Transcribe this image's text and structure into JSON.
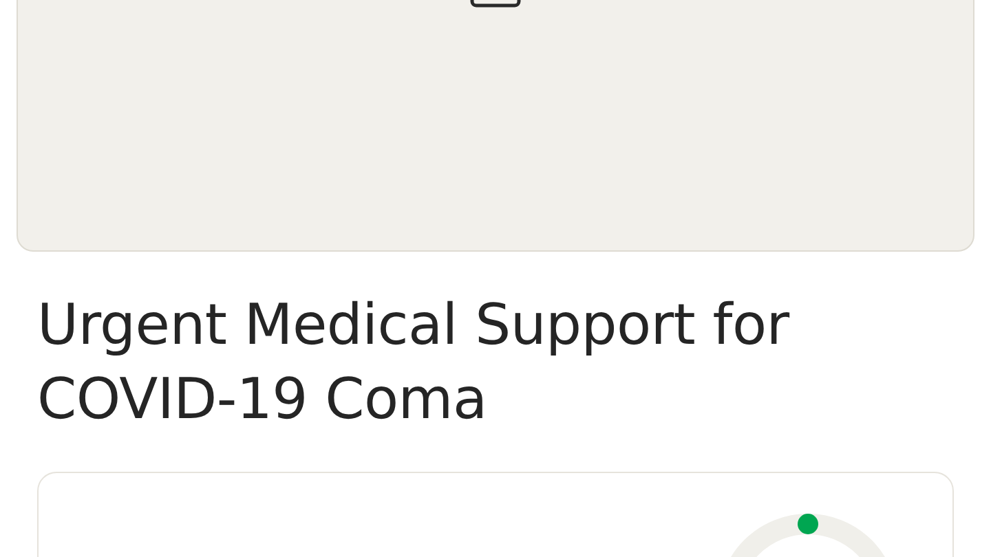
{
  "title": "Urgent Medical Support for COVID-19 Coma",
  "progress": {
    "level": 0
  }
}
